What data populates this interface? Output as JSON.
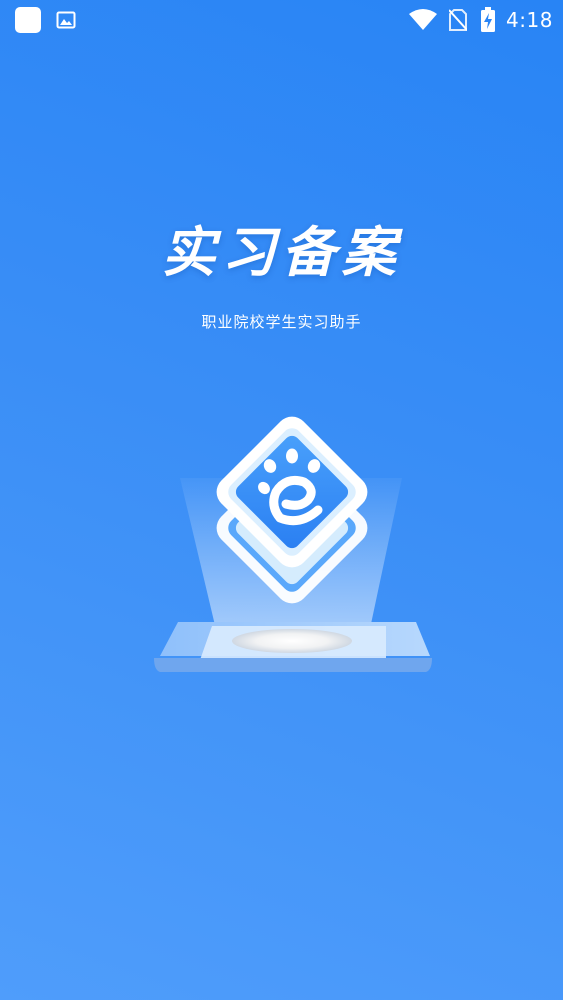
{
  "status_bar": {
    "time": "4:18",
    "icons": [
      "app-square-icon",
      "image-notification-icon",
      "wifi-icon",
      "no-sim-icon",
      "battery-charging-icon"
    ]
  },
  "splash": {
    "title": "实习备案",
    "subtitle": "职业院校学生实习助手"
  },
  "colors": {
    "background_top": "#2884f5",
    "background_bottom": "#4f9dfb",
    "text": "#ffffff"
  }
}
